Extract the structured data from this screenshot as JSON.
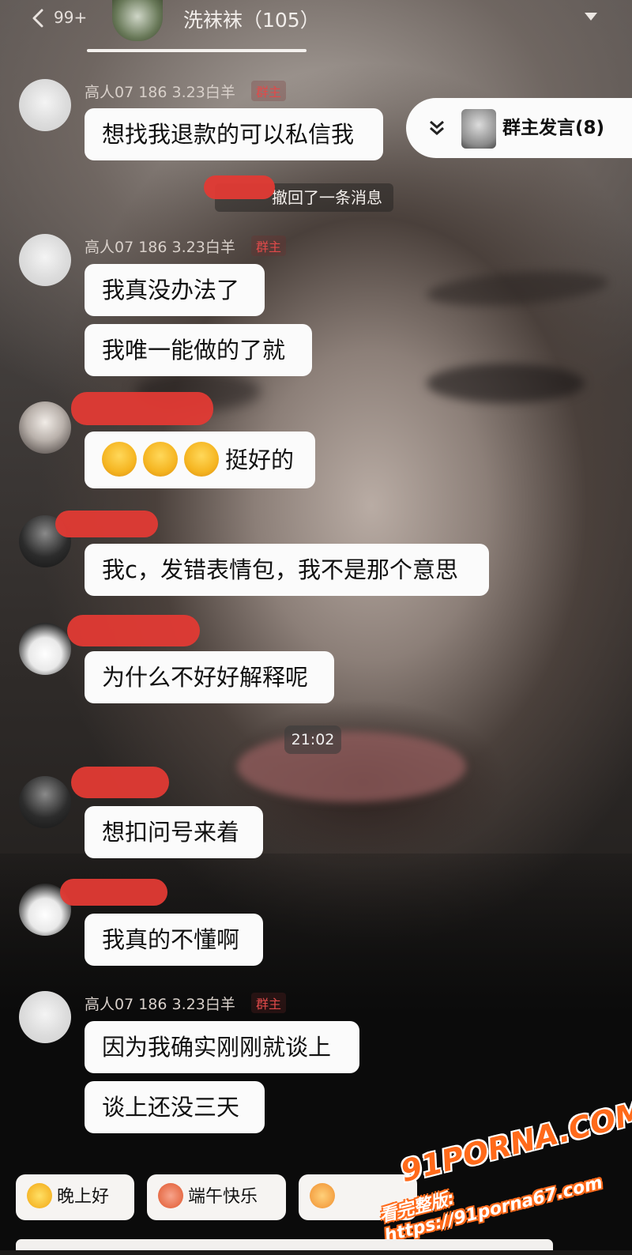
{
  "header": {
    "unread_count": "99+",
    "group_title": "洗袜袜（105）"
  },
  "owner_pill": {
    "label": "群主发言(8)"
  },
  "recall_notice": "撤回了一条消息",
  "timestamp": "21:02",
  "owner": {
    "name": "高人07 186 3.23白羊",
    "badge": "群主"
  },
  "messages": [
    {
      "text": "想找我退款的可以私信我"
    },
    {
      "text": "我真没办法了"
    },
    {
      "text": "我唯一能做的了就"
    },
    {
      "text": "挺好的"
    },
    {
      "text": "我c，发错表情包，我不是那个意思"
    },
    {
      "text": "为什么不好好解释呢"
    },
    {
      "text": "想扣问号来着"
    },
    {
      "text": "我真的不懂啊"
    },
    {
      "text": "因为我确实刚刚就谈上"
    },
    {
      "text": "谈上还没三天"
    }
  ],
  "quick_replies": [
    {
      "label": "晚上好",
      "icon": "star-icon"
    },
    {
      "label": "端午快乐",
      "icon": "flower-icon"
    },
    {
      "label": "",
      "icon": "hand-icon"
    }
  ],
  "watermark": {
    "logo": "91PORNA.COM",
    "url": "看完整版: https://91porna67.com"
  },
  "colors": {
    "bubble": "#fbfbfb",
    "badge_red": "#e04a4a",
    "redaction_red": "#e23a34",
    "watermark_orange": "#ff6a1a"
  }
}
